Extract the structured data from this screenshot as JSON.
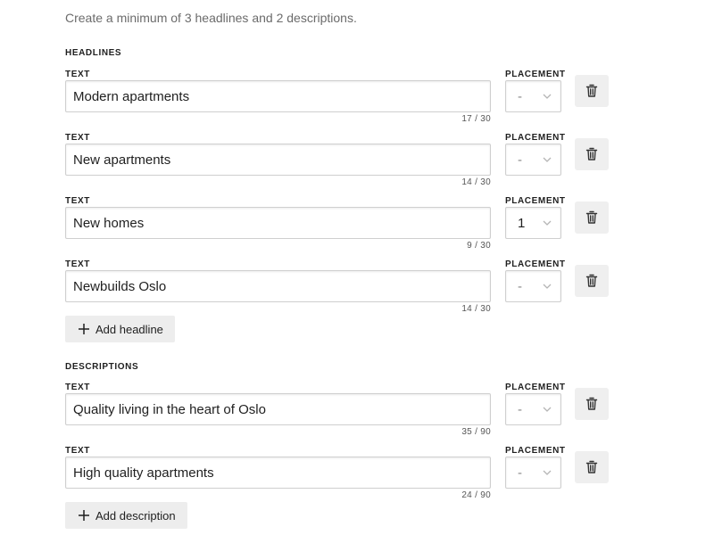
{
  "intro": "Create a minimum of 3 headlines and 2 descriptions.",
  "labels": {
    "text": "TEXT",
    "placement": "PLACEMENT"
  },
  "headlines": {
    "title": "HEADLINES",
    "items": [
      {
        "text": "Modern apartments",
        "counter": "17 / 30",
        "placement": "-"
      },
      {
        "text": "New apartments",
        "counter": "14 / 30",
        "placement": "-"
      },
      {
        "text": "New homes",
        "counter": "9 / 30",
        "placement": "1"
      },
      {
        "text": "Newbuilds Oslo",
        "counter": "14 / 30",
        "placement": "-"
      }
    ],
    "add_label": "Add headline"
  },
  "descriptions": {
    "title": "DESCRIPTIONS",
    "items": [
      {
        "text": "Quality living in the heart of Oslo",
        "counter": "35 / 90",
        "placement": "-"
      },
      {
        "text": "High quality apartments",
        "counter": "24 / 90",
        "placement": "-"
      }
    ],
    "add_label": "Add description"
  },
  "icons": {
    "delete": "trash-icon",
    "add": "plus-icon",
    "dropdown": "chevron-down-icon"
  }
}
